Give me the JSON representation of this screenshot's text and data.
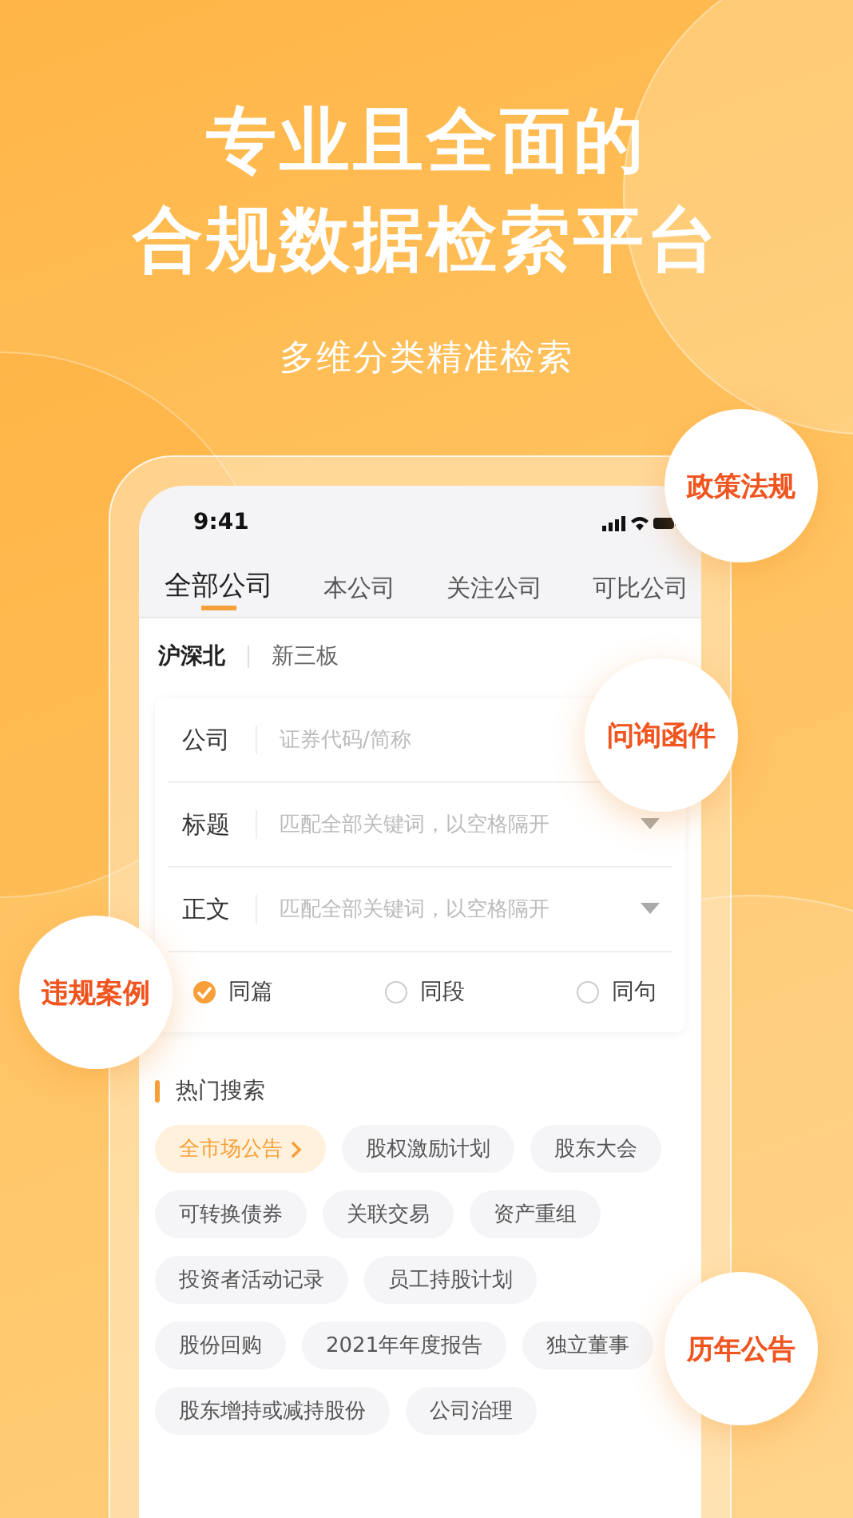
{
  "headline": [
    "专业且全面的",
    "合规数据检索平台"
  ],
  "subtitle": "多维分类精准检索",
  "phone": {
    "status_time": "9:41",
    "tabs": [
      {
        "label": "全部公司",
        "selected": true
      },
      {
        "label": "本公司",
        "selected": false
      },
      {
        "label": "关注公司",
        "selected": false
      },
      {
        "label": "可比公司",
        "selected": false
      }
    ],
    "markets": [
      {
        "label": "沪深北",
        "selected": true
      },
      {
        "label": "新三板",
        "selected": false
      }
    ],
    "fields": [
      {
        "label": "公司",
        "placeholder": "证券代码/简称"
      },
      {
        "label": "标题",
        "placeholder": "匹配全部关键词，以空格隔开",
        "dropdown": true
      },
      {
        "label": "正文",
        "placeholder": "匹配全部关键词，以空格隔开",
        "dropdown": true
      }
    ],
    "scope": [
      {
        "label": "同篇",
        "selected": true
      },
      {
        "label": "同段",
        "selected": false
      },
      {
        "label": "同句",
        "selected": false
      }
    ],
    "hot_search_title": "热门搜索",
    "tag_rows": [
      [
        {
          "label": "全市场公告",
          "kind": "featured"
        },
        {
          "label": "股权激励计划",
          "kind": "plain"
        },
        {
          "label": "股东大会",
          "kind": "plain"
        }
      ],
      [
        {
          "label": "可转换债券",
          "kind": "plain"
        },
        {
          "label": "关联交易",
          "kind": "plain"
        },
        {
          "label": "资产重组",
          "kind": "plain"
        }
      ],
      [
        {
          "label": "投资者活动记录",
          "kind": "plain"
        },
        {
          "label": "员工持股计划",
          "kind": "plain"
        }
      ],
      [
        {
          "label": "股份回购",
          "kind": "plain"
        },
        {
          "label": "2021年年度报告",
          "kind": "plain"
        },
        {
          "label": "独立董事",
          "kind": "plain"
        }
      ],
      [
        {
          "label": "股东增持或减持股份",
          "kind": "plain"
        },
        {
          "label": "公司治理",
          "kind": "plain"
        }
      ]
    ]
  },
  "bubbles": [
    {
      "label": "政策法规"
    },
    {
      "label": "问询函件"
    },
    {
      "label": "违规案例"
    },
    {
      "label": "历年公告"
    }
  ]
}
